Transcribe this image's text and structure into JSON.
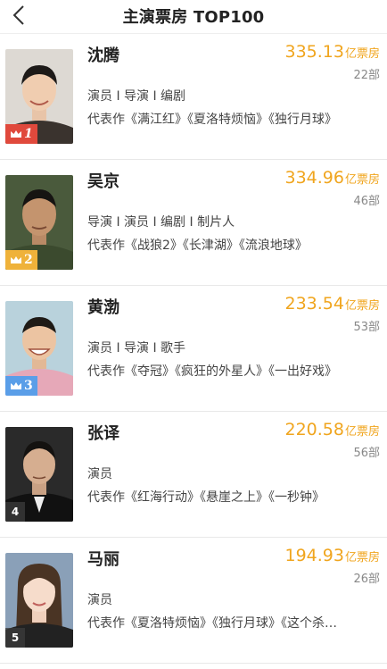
{
  "header": {
    "title": "主演票房 TOP100",
    "back_icon": "chevron-left-icon"
  },
  "colors": {
    "accent_gold": "#f0a51e",
    "rank1": "#e0493c",
    "rank2": "#efb23a",
    "rank3": "#5a9ee8"
  },
  "actors": [
    {
      "rank": "1",
      "name": "沈腾",
      "gross": "335.13",
      "unit": "亿票房",
      "count": "22部",
      "roles": "演员 I 导演 I 编剧",
      "works": "代表作《满江红》《夏洛特烦恼》《独行月球》",
      "crown": true
    },
    {
      "rank": "2",
      "name": "吴京",
      "gross": "334.96",
      "unit": "亿票房",
      "count": "46部",
      "roles": "导演 I 演员 I 编剧 I 制片人",
      "works": "代表作《战狼2》《长津湖》《流浪地球》",
      "crown": true
    },
    {
      "rank": "3",
      "name": "黄渤",
      "gross": "233.54",
      "unit": "亿票房",
      "count": "53部",
      "roles": "演员 I 导演 I 歌手",
      "works": "代表作《夺冠》《疯狂的外星人》《一出好戏》",
      "crown": true
    },
    {
      "rank": "4",
      "name": "张译",
      "gross": "220.58",
      "unit": "亿票房",
      "count": "56部",
      "roles": "演员",
      "works": "代表作《红海行动》《悬崖之上》《一秒钟》",
      "crown": false
    },
    {
      "rank": "5",
      "name": "马丽",
      "gross": "194.93",
      "unit": "亿票房",
      "count": "26部",
      "roles": "演员",
      "works": "代表作《夏洛特烦恼》《独行月球》《这个杀…",
      "crown": false
    }
  ]
}
